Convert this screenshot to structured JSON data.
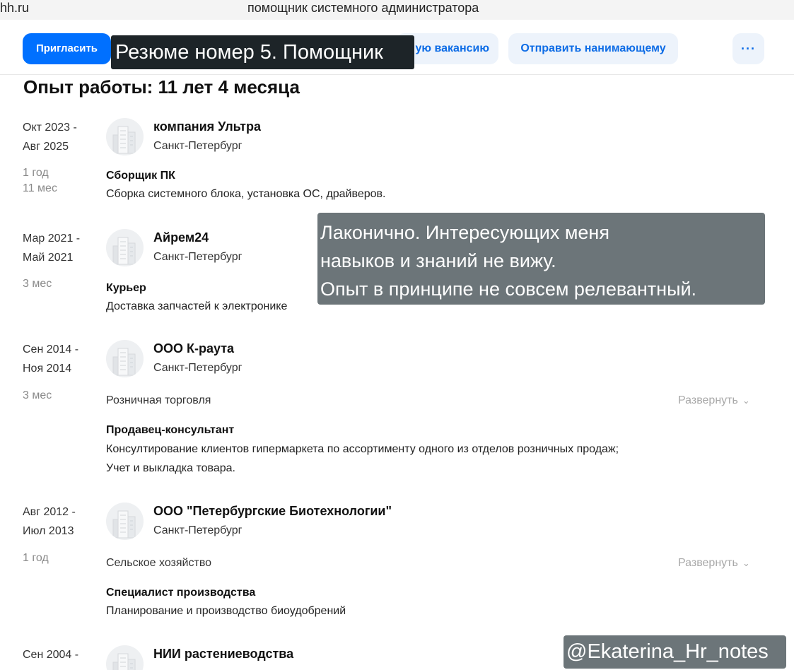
{
  "browser": {
    "url": "hh.ru",
    "tab_title": "помощник системного администратора"
  },
  "actions": {
    "invite": "Пригласить",
    "vacancy": "ую вакансию",
    "send_to_hiring_manager": "Отправить нанимающему",
    "more": "···"
  },
  "overlay_title": "Резюме номер 5. Помощник",
  "experience": {
    "title": "Опыт работы: 11 лет 4 месяца",
    "jobs": [
      {
        "period_start": "Окт 2023 -",
        "period_end": "Авг 2025",
        "duration_1": "1 год",
        "duration_2": "11 мес",
        "company": "компания Ультра",
        "city": "Санкт-Петербург",
        "position": "Сборщик ПК",
        "desc_1": "Сборка системного блока, установка ОС, драйверов."
      },
      {
        "period_start": "Мар 2021 -",
        "period_end": "Май 2021",
        "duration_1": "3 мес",
        "company": "Айрем24",
        "city": "Санкт-Петербург",
        "position": "Курьер",
        "desc_1": "Доставка запчастей к электронике"
      },
      {
        "period_start": "Сен 2014 -",
        "period_end": "Ноя 2014",
        "duration_1": "3 мес",
        "company": "ООО К-раута",
        "city": "Санкт-Петербург",
        "industry": "Розничная торговля",
        "expand": "Развернуть",
        "position": "Продавец-консультант",
        "desc_1": "Консултирование клиентов гипермаркета по ассортименту одного из отделов розничных продаж;",
        "desc_2": "Учет и выкладка товара."
      },
      {
        "period_start": "Авг 2012 -",
        "period_end": "Июл 2013",
        "duration_1": "1 год",
        "company": "ООО \"Петербургские Биотехнологии\"",
        "city": "Санкт-Петербург",
        "industry": "Сельское хозяйство",
        "expand": "Развернуть",
        "position": "Специалист производства",
        "desc_1": "Планирование и производство биоудобрений"
      },
      {
        "period_start": "Сен 2004 -",
        "company": "НИИ растениеводства"
      }
    ]
  },
  "comment": {
    "line_1": "Лаконично. Интересующих меня",
    "line_2": "навыков и знаний не вижу.",
    "line_3": "Опыт в принципе не совсем релевантный."
  },
  "watermark": "@Ekaterina_Hr_notes",
  "icons": {
    "company_logo": "building-icon",
    "expand": "chevron-down-icon"
  },
  "colors": {
    "primary": "#0070ff",
    "secondary_bg": "#edf3fb",
    "secondary_text": "#0d6ce6"
  }
}
